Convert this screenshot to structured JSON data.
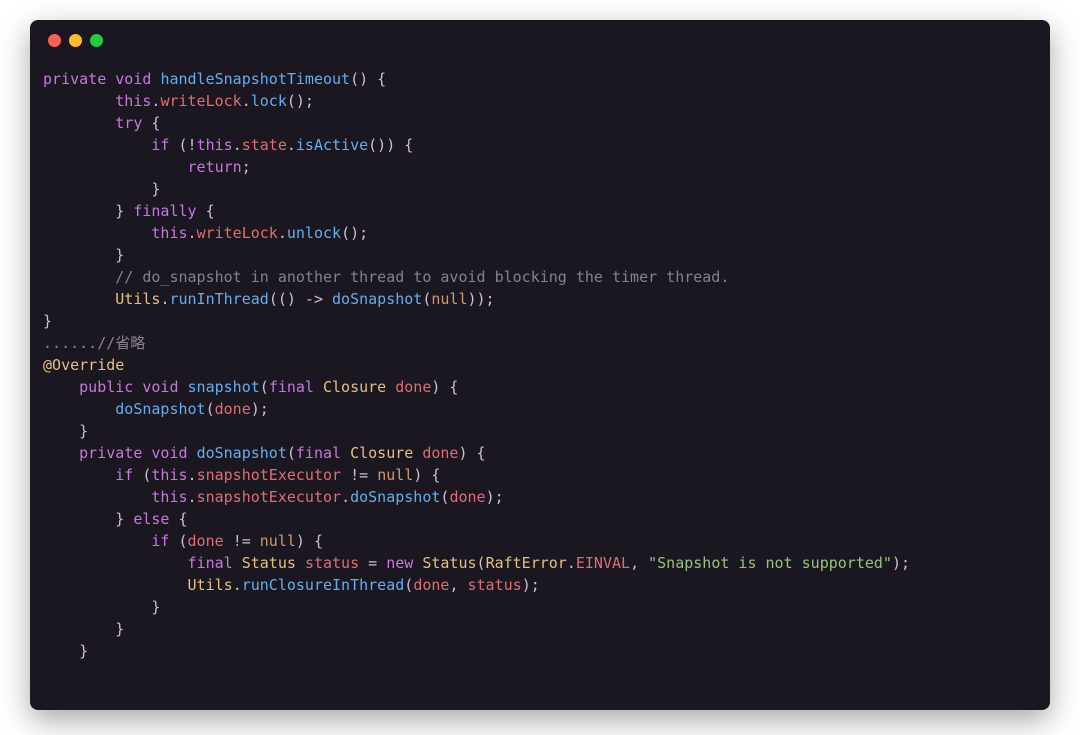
{
  "tokens": {
    "kw_private": "private",
    "kw_public": "public",
    "kw_void": "void",
    "kw_try": "try",
    "kw_if": "if",
    "kw_else": "else",
    "kw_return": "return",
    "kw_finally": "finally",
    "kw_this": "this",
    "kw_final": "final",
    "kw_new": "new",
    "kw_null": "null",
    "fn_handleSnapshotTimeout": "handleSnapshotTimeout",
    "id_writeLock": "writeLock",
    "fn_lock": "lock",
    "id_state": "state",
    "fn_isActive": "isActive",
    "fn_unlock": "unlock",
    "cmt_doSnapshot": "// do_snapshot in another thread to avoid blocking the timer thread.",
    "type_Utils": "Utils",
    "fn_runInThread": "runInThread",
    "fn_doSnapshot": "doSnapshot",
    "ellipsis_cmt": "......//省略",
    "ann_override": "@Override",
    "fn_snapshot": "snapshot",
    "type_Closure": "Closure",
    "id_done": "done",
    "id_snapshotExecutor": "snapshotExecutor",
    "type_Status": "Status",
    "id_status": "status",
    "type_RaftError": "RaftError",
    "id_EINVAL": "EINVAL",
    "str_notSupported": "\"Snapshot is not supported\"",
    "fn_runClosureInThread": "runClosureInThread",
    "op_ne": "!="
  }
}
